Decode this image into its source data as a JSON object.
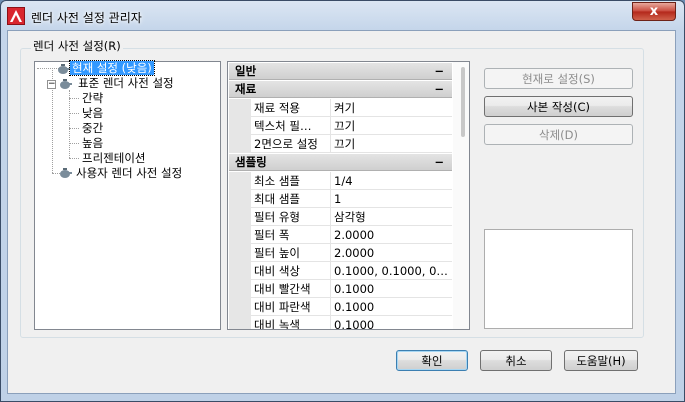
{
  "window": {
    "title": "렌더 사전 설정 관리자",
    "close_label": "x"
  },
  "group": {
    "title": "렌더 사전 설정(R)"
  },
  "tree": {
    "current": "현재 설정 (낮음)",
    "standard": "표준 렌더 사전 설정",
    "children": [
      "간략",
      "낮음",
      "중간",
      "높음",
      "프리젠테이션"
    ],
    "user": "사용자 렌더 사전 설정"
  },
  "properties": {
    "cat_general": "일반",
    "cat_material": "재료",
    "material_rows": [
      {
        "name": "재료 적용",
        "value": "켜기"
      },
      {
        "name": "텍스처 필…",
        "value": "끄기"
      },
      {
        "name": "2면으로 설정",
        "value": "끄기"
      }
    ],
    "cat_sampling": "샘플링",
    "sampling_rows": [
      {
        "name": "최소 샘플",
        "value": "1/4"
      },
      {
        "name": "최대 샘플",
        "value": "1"
      },
      {
        "name": "필터 유형",
        "value": "삼각형"
      },
      {
        "name": "필터 폭",
        "value": "2.0000"
      },
      {
        "name": "필터 높이",
        "value": "2.0000"
      },
      {
        "name": "대비 색상",
        "value": "0.1000,  0.1000,  0…"
      },
      {
        "name": "대비 빨간색",
        "value": "0.1000"
      },
      {
        "name": "대비 파란색",
        "value": "0.1000"
      },
      {
        "name": "대비 녹색",
        "value": "0.1000"
      }
    ],
    "collapse_symbol": "−"
  },
  "buttons": {
    "set_current": "현재로 설정(S)",
    "create_copy": "사본 작성(C)",
    "delete": "삭제(D)",
    "ok": "확인",
    "cancel": "취소",
    "help": "도움말(H)"
  },
  "colors": {
    "selection": "#3399ff",
    "app_icon": "#d9262e"
  }
}
